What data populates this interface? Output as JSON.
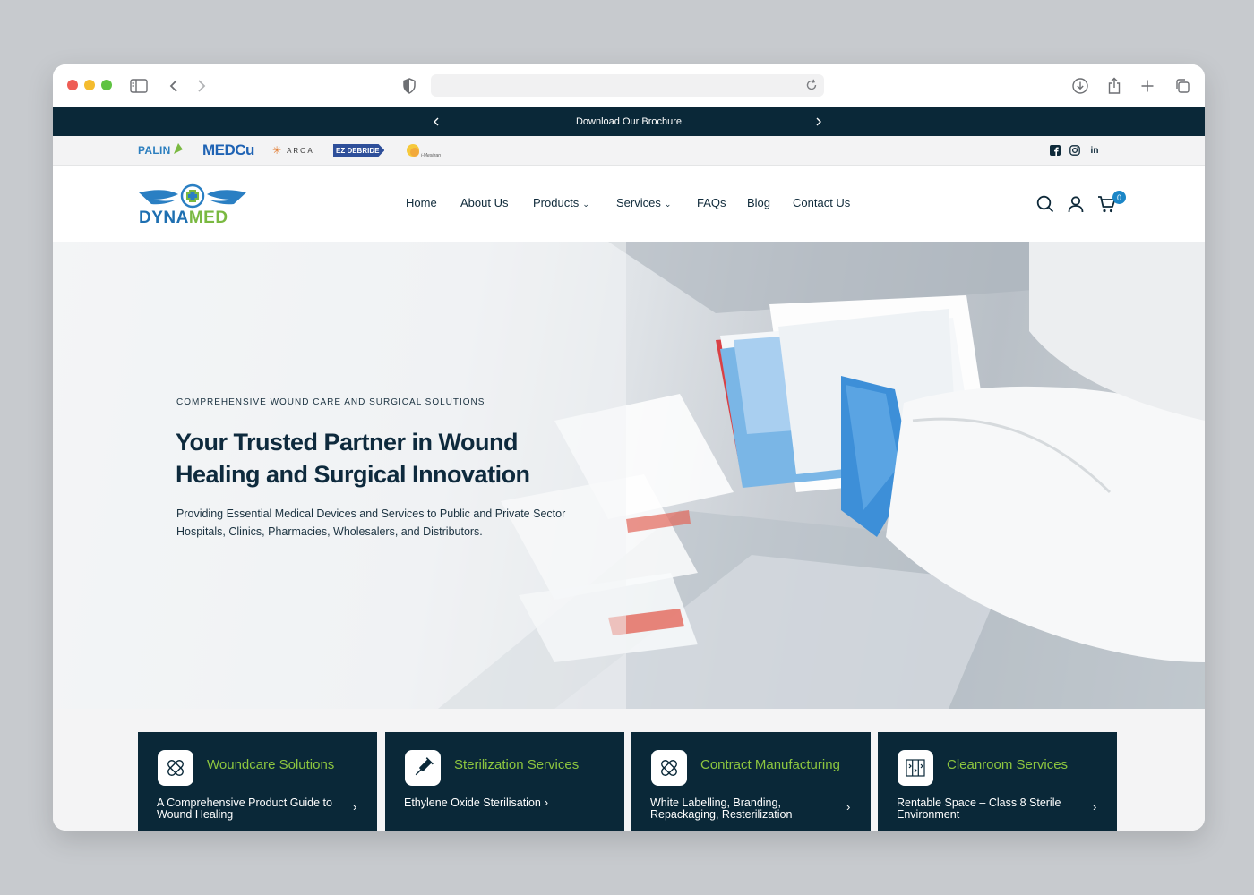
{
  "browser": {
    "traffic_colors": [
      "#ee5d55",
      "#f4bc2e",
      "#5fc342"
    ],
    "icons": [
      "sidebar-icon",
      "back-icon",
      "forward-icon",
      "shield-icon",
      "reload-icon",
      "download-icon",
      "share-icon",
      "new-tab-icon",
      "tabs-icon"
    ]
  },
  "announcement": {
    "text": "Download Our Brochure"
  },
  "brands": {
    "items": [
      "PALIN",
      "MEDCu",
      "AROA",
      "EZ DEBRIDE",
      "i-Mesitran"
    ]
  },
  "social": {
    "icons": [
      "facebook-icon",
      "instagram-icon",
      "linkedin-icon"
    ],
    "linkedin_text": "in"
  },
  "header": {
    "logo_brand": "DYNA",
    "logo_brand_accent": "MED",
    "nav": {
      "home": "Home",
      "about": "About Us",
      "products": "Products",
      "services": "Services",
      "faqs": "FAQs",
      "blog": "Blog",
      "contact": "Contact Us"
    },
    "cart_count": "0"
  },
  "hero": {
    "eyebrow": "COMPREHENSIVE WOUND CARE AND SURGICAL SOLUTIONS",
    "title": "Your Trusted Partner in Wound Healing and Surgical Innovation",
    "subtitle": "Providing Essential Medical Devices and Services to Public and Private Sector Hospitals, Clinics, Pharmacies, Wholesalers, and Distributors."
  },
  "services": [
    {
      "title": "Woundcare Solutions",
      "desc": "A Comprehensive Product Guide to Wound Healing",
      "icon": "bandage-icon"
    },
    {
      "title": "Sterilization Services",
      "desc": "Ethylene Oxide Sterilisation",
      "icon": "syringe-icon"
    },
    {
      "title": "Contract Manufacturing",
      "desc": "White Labelling, Branding, Repackaging, Resterilization",
      "icon": "bandage-icon"
    },
    {
      "title": "Cleanroom Services",
      "desc": "Rentable Space – Class 8 Sterile Environment",
      "icon": "cleanroom-icon"
    }
  ],
  "colors": {
    "navy": "#0a2838",
    "green_accent": "#8dc63f",
    "logo_blue": "#1e6fb1",
    "logo_green": "#7ab941",
    "badge_blue": "#1b86c7"
  }
}
